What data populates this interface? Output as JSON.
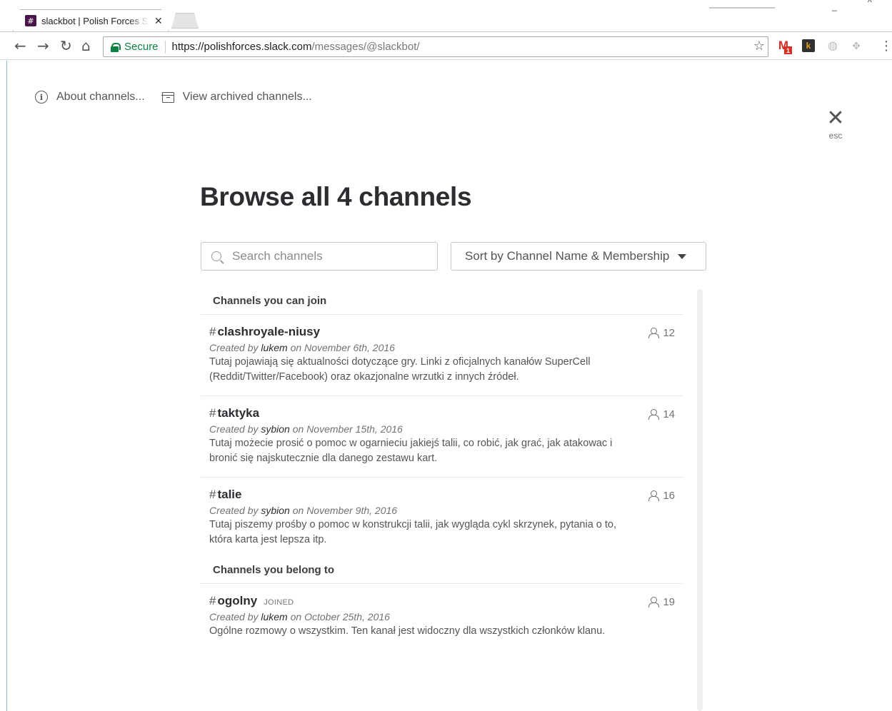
{
  "browser": {
    "tab_title": "slackbot | Polish Forces Slack",
    "tab_favicon": "#",
    "address": {
      "secure_label": "Secure",
      "url_scheme_host": "https://polishforces.slack.com",
      "url_path": "/messages/@slackbot/"
    },
    "extensions": [
      {
        "name": "gmail-icon",
        "badge": "1"
      },
      {
        "name": "k-extension-icon",
        "label": "k"
      },
      {
        "name": "globe-extension-icon"
      },
      {
        "name": "puzzle-extension-icon"
      }
    ]
  },
  "links": {
    "about": "About channels...",
    "archived": "View archived channels..."
  },
  "close": {
    "esc_label": "esc"
  },
  "heading": "Browse all 4 channels",
  "search": {
    "placeholder": "Search channels",
    "value": ""
  },
  "sort": {
    "label": "Sort by Channel Name & Membership"
  },
  "groups": [
    {
      "title": "Channels you can join",
      "channels": [
        {
          "name": "clashroyale-niusy",
          "created_prefix": "Created by ",
          "creator": "lukem",
          "created_suffix": " on November 6th, 2016",
          "description": "Tutaj pojawiają się aktualności dotyczące gry. Linki z oficjalnych kanałów SuperCell (Reddit/Twitter/Facebook) oraz okazjonalne wrzutki z innych źródeł.",
          "members": "12"
        },
        {
          "name": "taktyka",
          "created_prefix": "Created by ",
          "creator": "sybion",
          "created_suffix": " on November 15th, 2016",
          "description": "Tutaj możecie prosić o pomoc w ogarnieciu jakiejś talii, co robić, jak grać, jak atakowac i bronić się najskutecznie dla danego zestawu kart.",
          "members": "14"
        },
        {
          "name": "talie",
          "created_prefix": "Created by ",
          "creator": "sybion",
          "created_suffix": " on November 9th, 2016",
          "description": "Tutaj piszemy prośby o pomoc w konstrukcji talii, jak wygląda cykl skrzynek, pytania o to, która karta jest lepsza itp.",
          "members": "16"
        }
      ]
    },
    {
      "title": "Channels you belong to",
      "channels": [
        {
          "name": "ogolny",
          "joined": "JOINED",
          "created_prefix": "Created by ",
          "creator": "lukem",
          "created_suffix": " on October 25th, 2016",
          "description": "Ogólne rozmowy o wszystkim. Ten kanał jest widoczny dla wszystkich członków klanu.",
          "members": "19"
        }
      ]
    }
  ]
}
